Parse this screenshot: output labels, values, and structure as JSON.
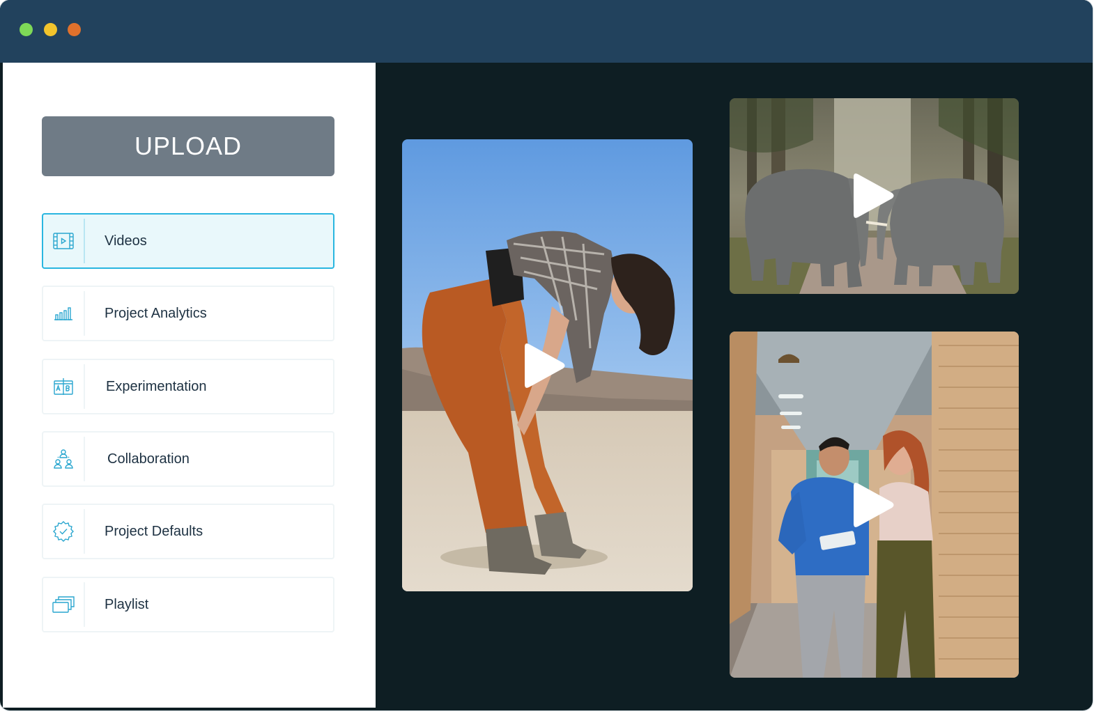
{
  "window": {
    "controls": [
      "green",
      "yellow",
      "orange"
    ]
  },
  "sidebar": {
    "upload_label": "UPLOAD",
    "items": [
      {
        "label": "Videos",
        "icon": "video-frame-icon",
        "active": true
      },
      {
        "label": "Project Analytics",
        "icon": "bar-chart-icon",
        "active": false
      },
      {
        "label": "Experimentation",
        "icon": "ab-test-icon",
        "active": false
      },
      {
        "label": "Collaboration",
        "icon": "team-icon",
        "active": false
      },
      {
        "label": "Project Defaults",
        "icon": "settings-gear-icon",
        "active": false
      },
      {
        "label": "Playlist",
        "icon": "stacked-windows-icon",
        "active": false
      }
    ]
  },
  "videos": [
    {
      "subject": "woman-bending-desert",
      "icon": "play-icon"
    },
    {
      "subject": "two-elephants-forest",
      "icon": "play-icon"
    },
    {
      "subject": "two-colleagues-hallway",
      "icon": "play-icon"
    }
  ],
  "colors": {
    "titlebar": "#22425d",
    "content_bg": "#0e1e23",
    "accent": "#29b6e0",
    "upload_button": "#6f7b86"
  }
}
